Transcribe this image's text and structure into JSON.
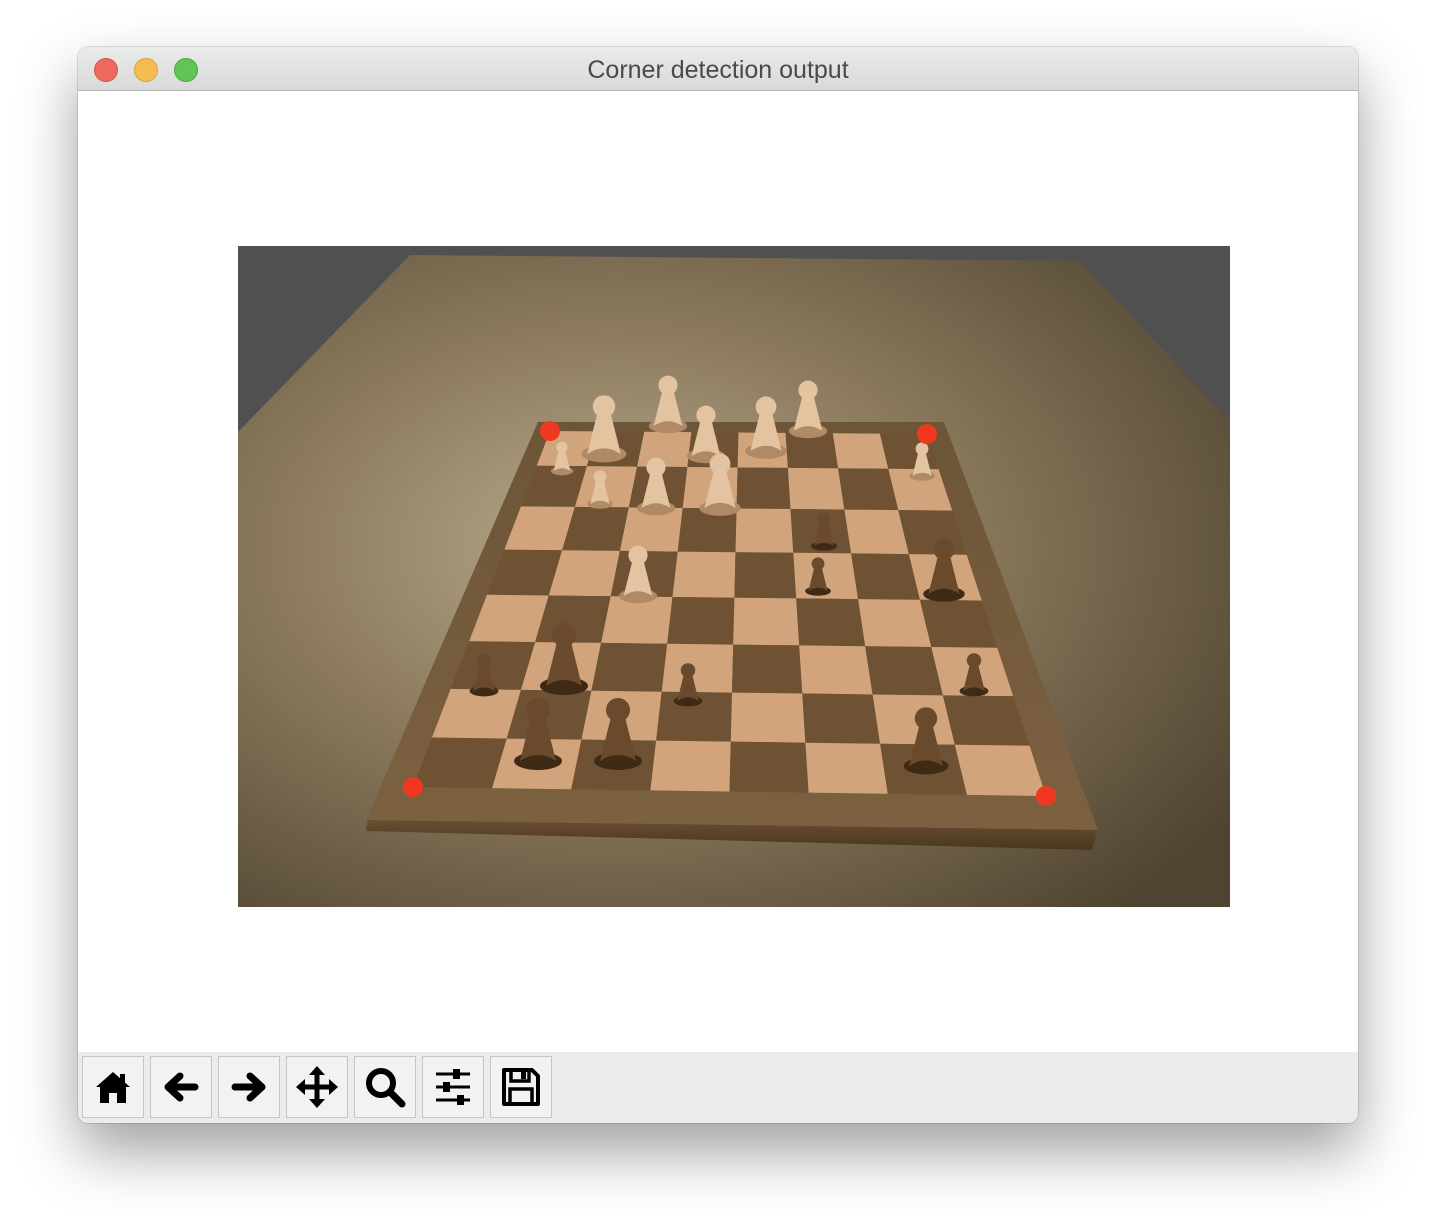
{
  "window": {
    "title": "Corner detection output"
  },
  "figure": {
    "image_content": "chessboard with pieces on a wooden table, four detected board corners marked",
    "corner_marker_color": "#f0371f",
    "corner_marker_count": 4
  },
  "toolbar": {
    "buttons": [
      {
        "name": "home",
        "icon": "home-icon"
      },
      {
        "name": "back",
        "icon": "arrow-left-icon"
      },
      {
        "name": "forward",
        "icon": "arrow-right-icon"
      },
      {
        "name": "pan",
        "icon": "move-icon"
      },
      {
        "name": "zoom",
        "icon": "zoom-icon"
      },
      {
        "name": "configure-subplots",
        "icon": "sliders-icon"
      },
      {
        "name": "save",
        "icon": "save-icon"
      }
    ]
  },
  "colors": {
    "close": "#ee6a5f",
    "minimize": "#f5bd4f",
    "maximize": "#61c454",
    "toolbar_bg": "#ececec"
  }
}
